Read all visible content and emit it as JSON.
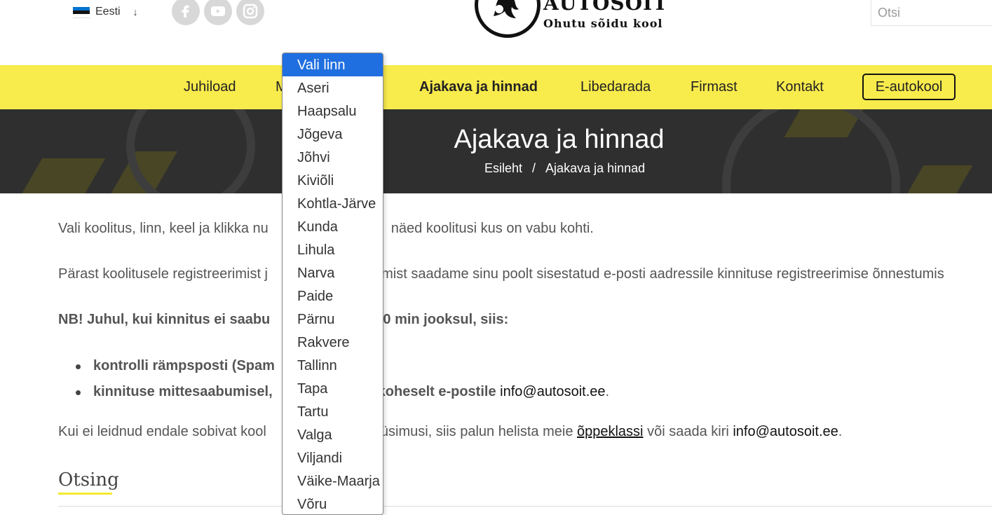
{
  "header": {
    "language": "Eesti",
    "language_chevron": "↓",
    "flag_colors": [
      "#0072ce",
      "#000000",
      "#ffffff"
    ],
    "social_icons": [
      "facebook-icon",
      "youtube-icon",
      "instagram-icon"
    ],
    "logo_title": "AUTOSOIT",
    "logo_subtitle": "Ohutu sõidu kool",
    "search_placeholder": "Otsi"
  },
  "nav": {
    "items": [
      "Juhiload",
      "M",
      "Ajakava ja hinnad",
      "Libedarada",
      "Firmast",
      "Kontakt"
    ],
    "active": "Ajakava ja hinnad",
    "button": "E-autokool",
    "bg_color": "#f8eb4c"
  },
  "hero": {
    "title": "Ajakava ja hinnad",
    "breadcrumb_home": "Esileht",
    "breadcrumb_sep": "/",
    "breadcrumb_current": "Ajakava ja hinnad"
  },
  "content": {
    "p1_a": "Vali koolitus, linn, keel ja klikka nu",
    "p1_b": "näed koolitusi kus on vabu kohti.",
    "p2_a": "Pärast koolitusele registreerimist j",
    "p2_b": "amist saadame sinu poolt sisestatud e-posti aadressile kinnituse registreerimise õnnestumis",
    "nb_a": "NB! Juhul, kui kinnitus ei saabu",
    "nb_b": "20 min jooksul, siis:",
    "li1": "kontrolli rämpsposti (Spam",
    "li2_a": "kinnituse mittesaabumisel,",
    "li2_b": "koheselt e-postile",
    "li2_email": "info@autosoit.ee",
    "li2_end": ".",
    "p3_a": "Kui ei leidnud endale sobivat kool",
    "p3_b": "küsimusi, siis palun helista meie",
    "p3_link": "õppeklassi",
    "p3_c": "või saada kiri",
    "p3_email": "info@autosoit.ee",
    "p3_end": ".",
    "section_heading": "Otsing"
  },
  "city_dropdown": {
    "selected": "Vali linn",
    "options": [
      "Vali linn",
      "Aseri",
      "Haapsalu",
      "Jõgeva",
      "Jõhvi",
      "Kiviõli",
      "Kohtla-Järve",
      "Kunda",
      "Lihula",
      "Narva",
      "Paide",
      "Pärnu",
      "Rakvere",
      "Tallinn",
      "Tapa",
      "Tartu",
      "Valga",
      "Viljandi",
      "Väike-Maarja",
      "Võru"
    ],
    "highlight_color": "#1f6fe0"
  }
}
